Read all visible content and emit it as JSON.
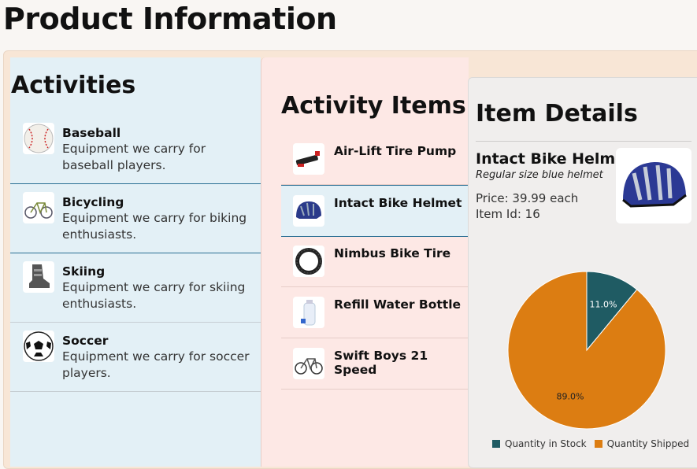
{
  "page": {
    "title": "Product Information"
  },
  "activities": {
    "heading": "Activities",
    "items": [
      {
        "name": "Baseball",
        "description": "Equipment we carry for baseball players.",
        "icon": "baseball-icon"
      },
      {
        "name": "Bicycling",
        "description": "Equipment we carry for biking enthusiasts.",
        "icon": "bicycle-icon"
      },
      {
        "name": "Skiing",
        "description": "Equipment we carry for skiing enthusiasts.",
        "icon": "ski-boot-icon"
      },
      {
        "name": "Soccer",
        "description": "Equipment we carry for soccer players.",
        "icon": "soccer-ball-icon"
      }
    ]
  },
  "activity_items": {
    "heading": "Activity Items",
    "items": [
      {
        "name": "Air-Lift Tire Pump",
        "icon": "tire-pump-icon"
      },
      {
        "name": "Intact Bike Helmet",
        "icon": "bike-helmet-icon"
      },
      {
        "name": "Nimbus Bike Tire",
        "icon": "bike-tire-icon"
      },
      {
        "name": "Refill Water Bottle",
        "icon": "water-bottle-icon"
      },
      {
        "name": "Swift Boys 21 Speed",
        "icon": "bicycle-icon"
      }
    ],
    "selected": "Intact Bike Helmet"
  },
  "item_details": {
    "heading": "Item Details",
    "name": "Intact Bike Helmet",
    "description": "Regular size blue helmet",
    "price": "Price: 39.99 each",
    "item_id": "Item Id: 16"
  },
  "chart_data": {
    "type": "pie",
    "series": [
      {
        "name": "Quantity in Stock",
        "value": 11.0,
        "label": "11.0%",
        "color": "#1f5b63"
      },
      {
        "name": "Quantity Shipped",
        "value": 89.0,
        "label": "89.0%",
        "color": "#dc7d12"
      }
    ],
    "legend": "bottom"
  }
}
